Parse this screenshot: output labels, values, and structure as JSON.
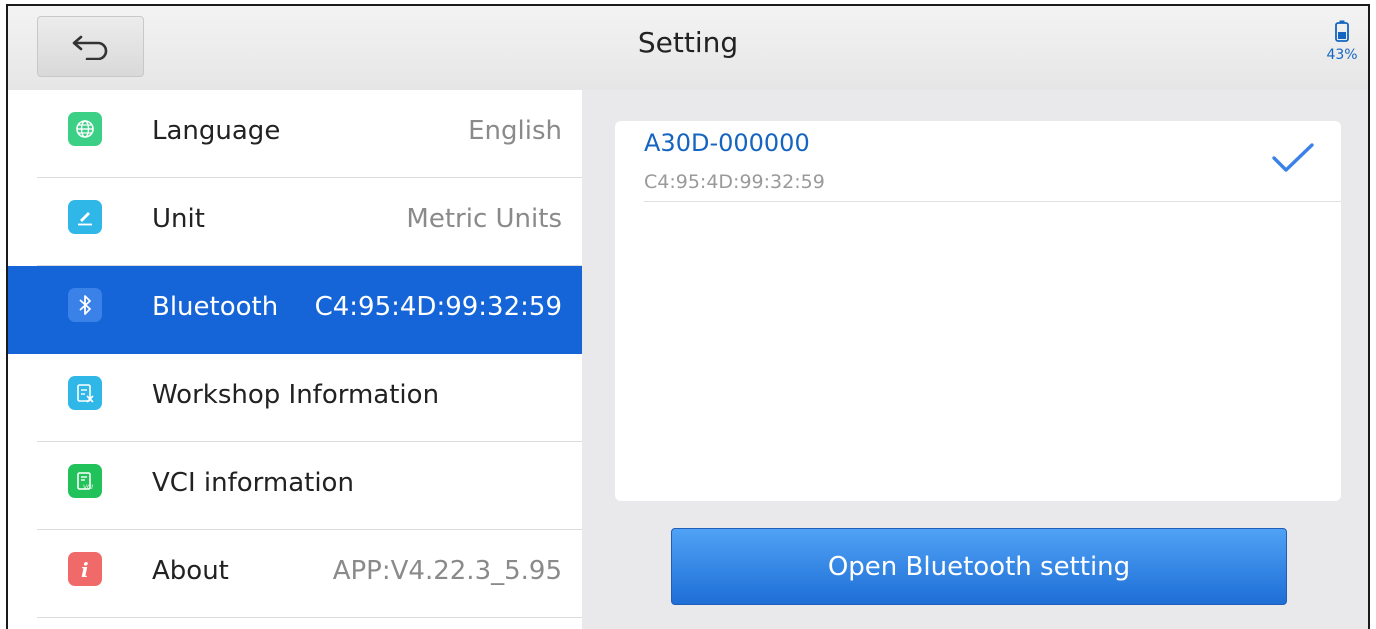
{
  "header": {
    "title": "Setting",
    "battery_label": "43%"
  },
  "settings": {
    "items": [
      {
        "label": "Language",
        "value": "English",
        "icon": "globe-icon",
        "color": "#3ccf86"
      },
      {
        "label": "Unit",
        "value": "Metric Units",
        "icon": "ruler-pencil-icon",
        "color": "#2fb7e8"
      },
      {
        "label": "Bluetooth",
        "value": "C4:95:4D:99:32:59",
        "icon": "bluetooth-icon",
        "color": "#3a82e8",
        "selected": true
      },
      {
        "label": "Workshop Information",
        "value": "",
        "icon": "document-edit-icon",
        "color": "#2fb7e8"
      },
      {
        "label": "VCI information",
        "value": "",
        "icon": "vci-document-icon",
        "color": "#22c25a"
      },
      {
        "label": "About",
        "value": "APP:V4.22.3_5.95",
        "icon": "info-icon",
        "color": "#f06a6a"
      }
    ]
  },
  "bluetooth": {
    "devices": [
      {
        "name": "A30D-000000",
        "address": "C4:95:4D:99:32:59",
        "connected": true
      }
    ],
    "open_button_label": "Open Bluetooth setting"
  },
  "colors": {
    "accent": "#1565d8",
    "link_blue": "#1565c0"
  }
}
